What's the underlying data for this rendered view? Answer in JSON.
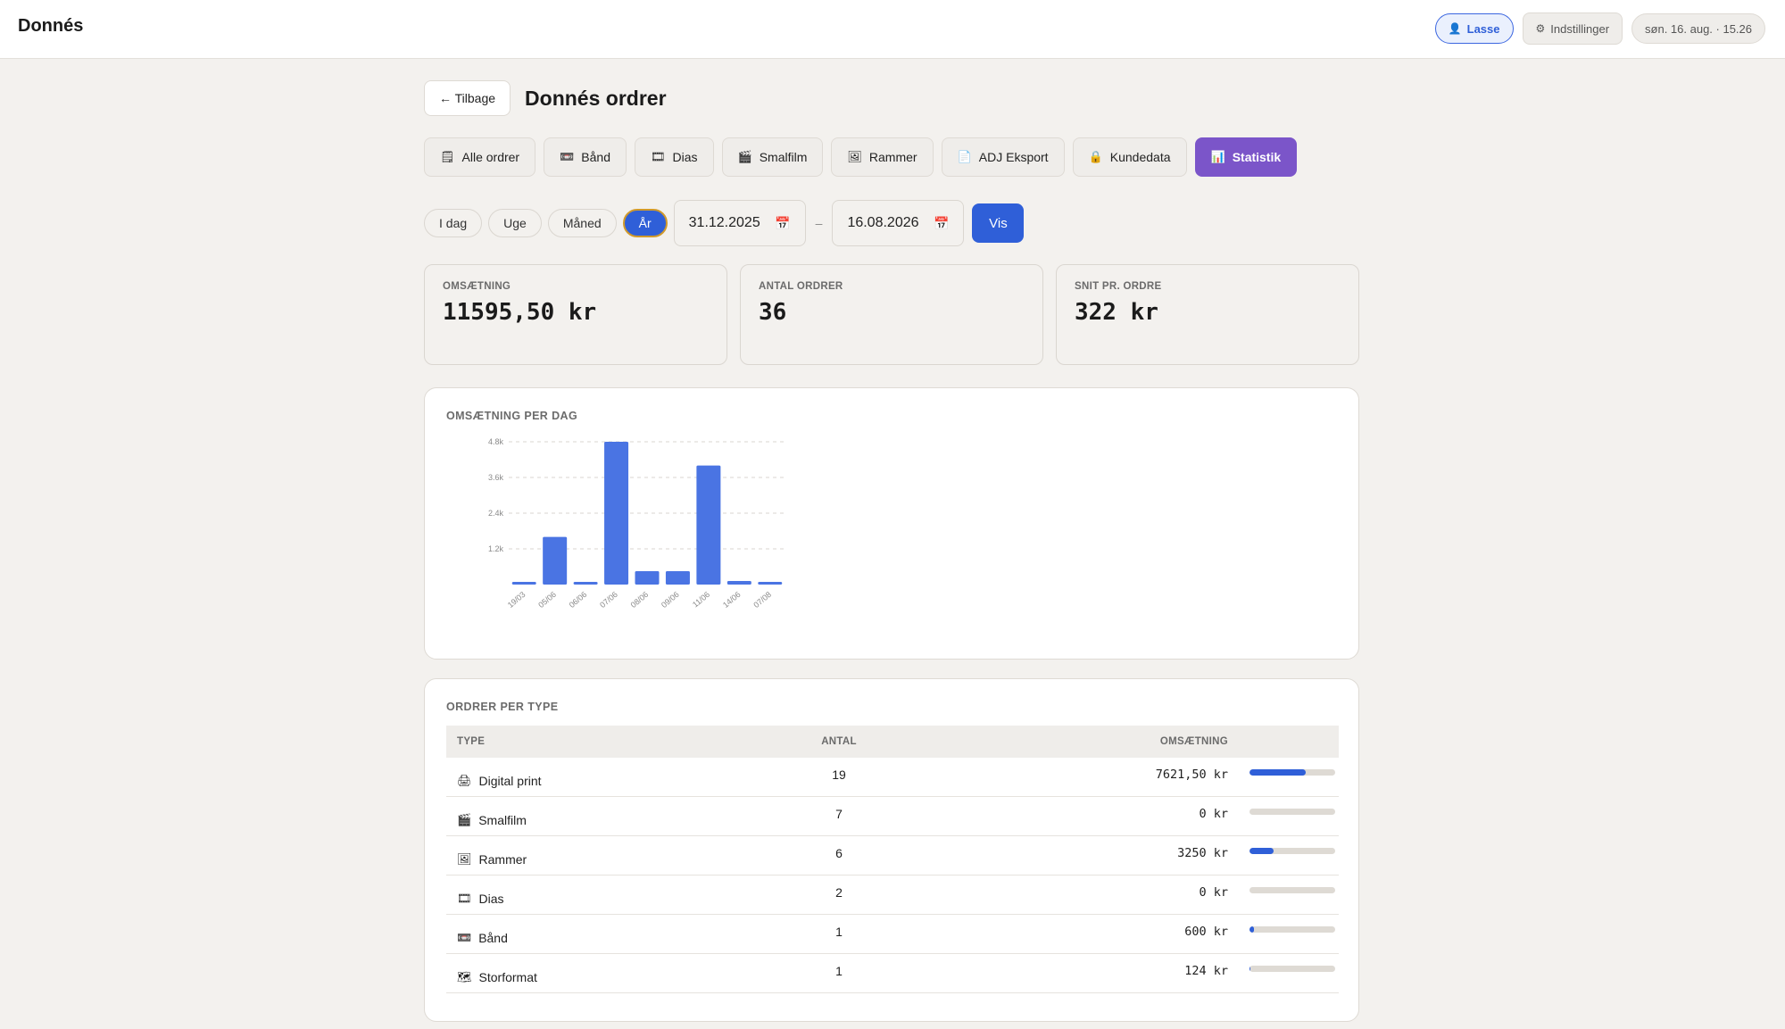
{
  "app": {
    "brand": "Donnés"
  },
  "topbar": {
    "user_label": "Lasse",
    "user_icon": "user-icon",
    "settings_label": "Indstillinger",
    "settings_icon": "gear-icon",
    "datetime": "søn. 16. aug. · 15.26"
  },
  "header": {
    "back_label": "← Tilbage",
    "title": "Donnés ordrer"
  },
  "tabs": [
    {
      "label": "Alle ordrer",
      "icon": "🗒"
    },
    {
      "label": "Bånd",
      "icon": "📼"
    },
    {
      "label": "Dias",
      "icon": "🎞"
    },
    {
      "label": "Smalfilm",
      "icon": "🎬"
    },
    {
      "label": "Rammer",
      "icon": "🖼"
    },
    {
      "label": "ADJ Eksport",
      "icon": "📄"
    },
    {
      "label": "Kundedata",
      "icon": "🔒"
    },
    {
      "label": "Statistik",
      "icon": "📊",
      "active": true
    }
  ],
  "filters": {
    "ranges": [
      "I dag",
      "Uge",
      "Måned",
      "År"
    ],
    "active_range": "År",
    "from_date": "31.12.2025",
    "to_date": "16.08.2026",
    "separator": "–",
    "show_label": "Vis"
  },
  "stats": {
    "revenue": {
      "label": "OMSÆTNING",
      "value": "11595,50 kr"
    },
    "orders": {
      "label": "ANTAL ORDRER",
      "value": "36"
    },
    "avg": {
      "label": "SNIT PR. ORDRE",
      "value": "322 kr"
    }
  },
  "chart_title": "OMSÆTNING PER DAG",
  "chart_data": {
    "type": "bar",
    "categories": [
      "19/03",
      "05/06",
      "06/06",
      "07/06",
      "08/06",
      "09/06",
      "11/06",
      "14/06",
      "07/08"
    ],
    "values": [
      60,
      1600,
      60,
      4800,
      450,
      450,
      4000,
      120,
      80
    ],
    "ylim": [
      0,
      4800
    ],
    "yticks": [
      1200,
      2400,
      3600,
      4800
    ],
    "ytick_labels": [
      "1.2k",
      "2.4k",
      "3.6k",
      "4.8k"
    ],
    "grid": true,
    "bar_color": "#4a74e3"
  },
  "orders_by_type": {
    "title": "ORDRER PER TYPE",
    "columns": [
      "TYPE",
      "ANTAL",
      "OMSÆTNING"
    ],
    "rows": [
      {
        "icon": "🖨",
        "type": "Digital print",
        "count": "19",
        "revenue": "7621,50 kr",
        "share": 0.66
      },
      {
        "icon": "🎬",
        "type": "Smalfilm",
        "count": "7",
        "revenue": "0 kr",
        "share": 0
      },
      {
        "icon": "🖼",
        "type": "Rammer",
        "count": "6",
        "revenue": "3250 kr",
        "share": 0.28
      },
      {
        "icon": "🎞",
        "type": "Dias",
        "count": "2",
        "revenue": "0 kr",
        "share": 0
      },
      {
        "icon": "📼",
        "type": "Bånd",
        "count": "1",
        "revenue": "600 kr",
        "share": 0.05
      },
      {
        "icon": "🗺",
        "type": "Storformat",
        "count": "1",
        "revenue": "124 kr",
        "share": 0.01
      }
    ]
  },
  "colors": {
    "accent": "#2f5fd8",
    "active_tab": "#7b55c9",
    "background": "#f3f1ee"
  }
}
